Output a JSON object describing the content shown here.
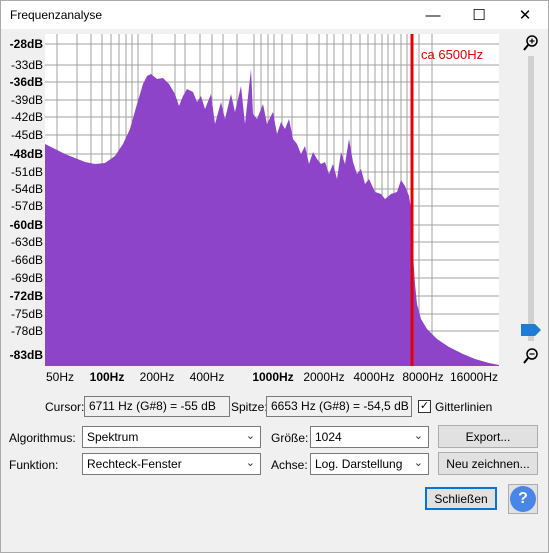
{
  "window": {
    "title": "Frequenzanalyse",
    "minimize_glyph": "—",
    "maximize_glyph": "☐",
    "close_glyph": "✕"
  },
  "plot": {
    "annotation": "ca 6500Hz",
    "annotation_color": "#e60000",
    "spectrum_color": "#8e44c8",
    "y_labels": [
      {
        "text": "-28dB",
        "major": true
      },
      {
        "text": "-33dB",
        "major": false
      },
      {
        "text": "-36dB",
        "major": true
      },
      {
        "text": "-39dB",
        "major": false
      },
      {
        "text": "-42dB",
        "major": false
      },
      {
        "text": "-45dB",
        "major": false
      },
      {
        "text": "-48dB",
        "major": true
      },
      {
        "text": "-51dB",
        "major": false
      },
      {
        "text": "-54dB",
        "major": false
      },
      {
        "text": "-57dB",
        "major": false
      },
      {
        "text": "-60dB",
        "major": true
      },
      {
        "text": "-63dB",
        "major": false
      },
      {
        "text": "-66dB",
        "major": false
      },
      {
        "text": "-69dB",
        "major": false
      },
      {
        "text": "-72dB",
        "major": true
      },
      {
        "text": "-75dB",
        "major": false
      },
      {
        "text": "-78dB",
        "major": false
      },
      {
        "text": "-83dB",
        "major": true
      }
    ],
    "x_labels": [
      {
        "text": "50Hz",
        "major": false
      },
      {
        "text": "100Hz",
        "major": true
      },
      {
        "text": "200Hz",
        "major": false
      },
      {
        "text": "400Hz",
        "major": false
      },
      {
        "text": "1000Hz",
        "major": true
      },
      {
        "text": "2000Hz",
        "major": false
      },
      {
        "text": "4000Hz",
        "major": false
      },
      {
        "text": "8000Hz",
        "major": false
      },
      {
        "text": "16000Hz",
        "major": false
      }
    ]
  },
  "cursor": {
    "label": "Cursor:",
    "value": "6711 Hz (G#8) = -55 dB"
  },
  "peak": {
    "label": "Spitze:",
    "value": "6653 Hz (G#8) = -54,5 dB"
  },
  "grid": {
    "label": "Gitterlinien",
    "checked": true,
    "check_glyph": "✓"
  },
  "algorithm": {
    "label": "Algorithmus:",
    "value": "Spektrum"
  },
  "size": {
    "label": "Größe:",
    "value": "1024"
  },
  "function": {
    "label": "Funktion:",
    "value": "Rechteck-Fenster"
  },
  "axis": {
    "label": "Achse:",
    "value": "Log. Darstellung"
  },
  "buttons": {
    "export": "Export...",
    "redraw": "Neu zeichnen...",
    "close": "Schließen",
    "help": "?"
  },
  "zoom": {
    "in_glyph": "+",
    "out_glyph": "−"
  }
}
